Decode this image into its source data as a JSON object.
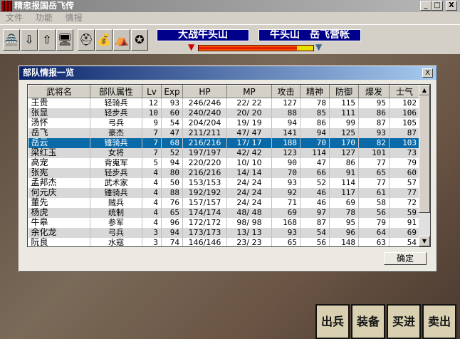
{
  "window": {
    "title": "精忠报国岳飞传",
    "min": "_",
    "max": "□",
    "close": "X"
  },
  "menu": [
    "文件",
    "功能",
    "情报"
  ],
  "toolbar": {
    "icons": [
      "castle-icon",
      "scroll-down-icon",
      "scroll-up-icon",
      "computer-icon",
      "helmet-icon",
      "money-bag-icon",
      "tent-icon",
      "armor-icon"
    ]
  },
  "banners": {
    "battle": "大战牛头山",
    "location": "牛头山　岳飞营帐"
  },
  "force_bar": {
    "red_fraction": 0.86
  },
  "dialog": {
    "title": "部队情报一览",
    "close": "X",
    "ok": "确定"
  },
  "table": {
    "headers": [
      "武将名",
      "部队属性",
      "Lv",
      "Exp",
      "HP",
      "MP",
      "攻击",
      "精神",
      "防御",
      "爆发",
      "士气"
    ],
    "selected": 4,
    "rows": [
      [
        "王贵",
        "轻骑兵",
        "12",
        "93",
        "246/246",
        "22/ 22",
        "127",
        "78",
        "115",
        "95",
        "102"
      ],
      [
        "张显",
        "轻步兵",
        "10",
        "60",
        "240/240",
        "20/ 20",
        "88",
        "85",
        "111",
        "86",
        "106"
      ],
      [
        "汤怀",
        "弓兵",
        "9",
        "54",
        "204/204",
        "19/ 19",
        "94",
        "86",
        "99",
        "87",
        "105"
      ],
      [
        "岳飞",
        "豪杰",
        "7",
        "47",
        "211/211",
        "47/ 47",
        "141",
        "94",
        "125",
        "93",
        "87"
      ],
      [
        "岳云",
        "锤骑兵",
        "7",
        "68",
        "216/216",
        "17/ 17",
        "188",
        "70",
        "170",
        "82",
        "103"
      ],
      [
        "梁红玉",
        "女将",
        "7",
        "52",
        "197/197",
        "42/ 42",
        "123",
        "114",
        "127",
        "101",
        "73"
      ],
      [
        "高宠",
        "背嵬军",
        "5",
        "94",
        "220/220",
        "10/ 10",
        "90",
        "47",
        "86",
        "77",
        "79"
      ],
      [
        "张宪",
        "轻步兵",
        "4",
        "80",
        "216/216",
        "14/ 14",
        "70",
        "66",
        "91",
        "65",
        "60"
      ],
      [
        "孟邦杰",
        "武术家",
        "4",
        "50",
        "153/153",
        "24/ 24",
        "93",
        "52",
        "114",
        "77",
        "57"
      ],
      [
        "何元庆",
        "锤骑兵",
        "4",
        "88",
        "192/192",
        "24/ 24",
        "92",
        "46",
        "117",
        "61",
        "77"
      ],
      [
        "董先",
        "贼兵",
        "4",
        "76",
        "157/157",
        "24/ 24",
        "71",
        "46",
        "69",
        "58",
        "72"
      ],
      [
        "杨虎",
        "统制",
        "4",
        "65",
        "174/174",
        "48/ 48",
        "69",
        "97",
        "78",
        "56",
        "59"
      ],
      [
        "牛皋",
        "参军",
        "4",
        "96",
        "172/172",
        "98/ 98",
        "168",
        "87",
        "95",
        "79",
        "91"
      ],
      [
        "余化龙",
        "弓兵",
        "3",
        "94",
        "173/173",
        "13/ 13",
        "93",
        "54",
        "96",
        "64",
        "69"
      ],
      [
        "阮良",
        "水寇",
        "3",
        "74",
        "146/146",
        "23/ 23",
        "65",
        "56",
        "148",
        "63",
        "54"
      ]
    ]
  },
  "commands": [
    "出兵",
    "装备",
    "买进",
    "卖出"
  ]
}
